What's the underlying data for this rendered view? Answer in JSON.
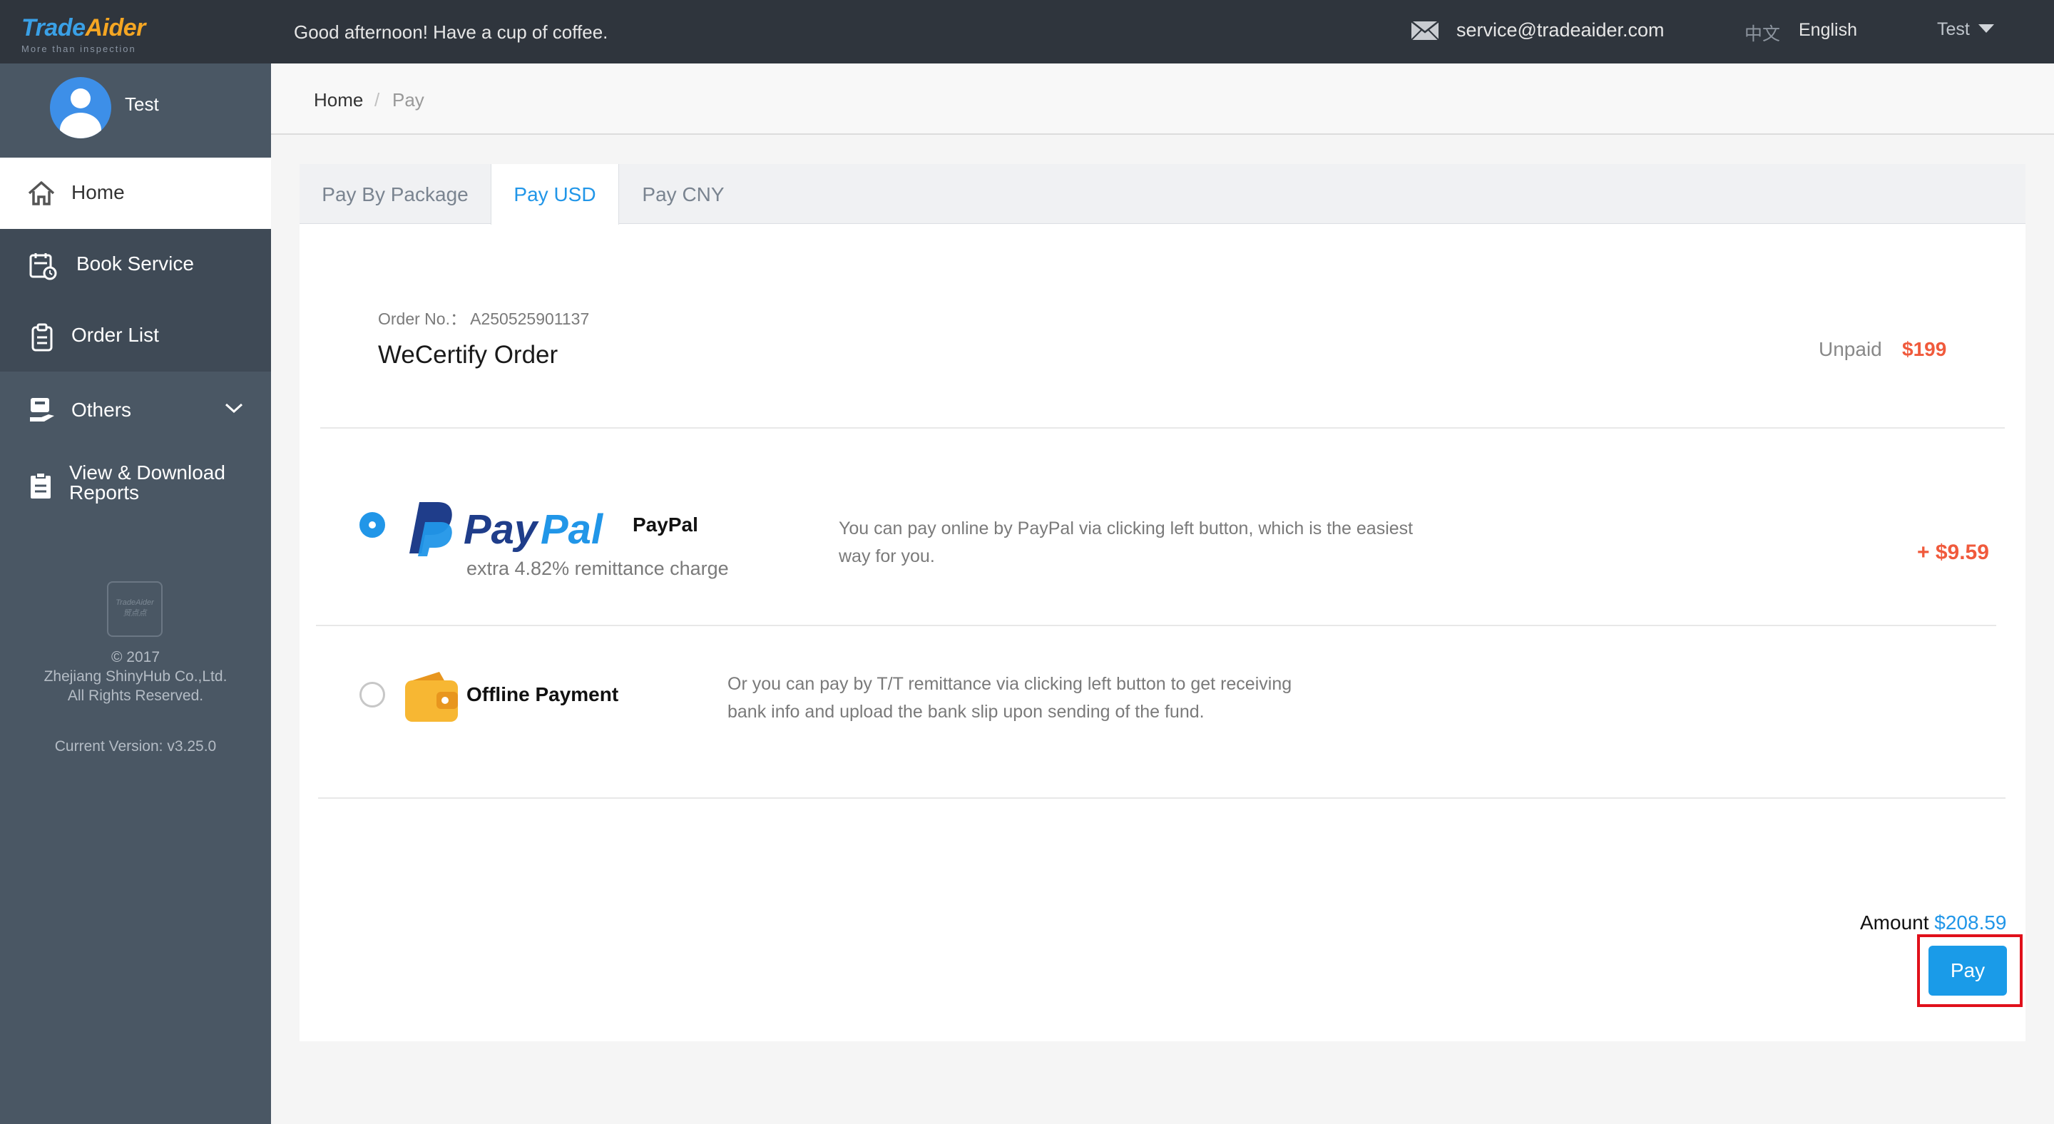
{
  "header": {
    "logo_part1": "Trade",
    "logo_part2": "Aider",
    "slogan": "More than inspection",
    "greeting": "Good afternoon! Have a cup of coffee.",
    "email": "service@tradeaider.com",
    "lang_cn": "中文",
    "lang_en": "English",
    "user": "Test"
  },
  "sidebar": {
    "profile_name": "Test",
    "items": [
      {
        "label": "Home",
        "icon": "home-icon",
        "active": true
      },
      {
        "label": "Book Service",
        "icon": "calendar-icon"
      },
      {
        "label": "Order List",
        "icon": "clipboard-icon"
      },
      {
        "label": "Others",
        "icon": "others-icon"
      },
      {
        "label": "View & Download",
        "label2": "Reports",
        "icon": "report-icon"
      }
    ],
    "footer_logo": "TradeAider",
    "footer_logo_cn": "贸点点",
    "copyright": "© 2017",
    "company": "Zhejiang ShinyHub Co.,Ltd.",
    "rights": "All Rights Reserved.",
    "version": "Current Version: v3.25.0"
  },
  "breadcrumb": {
    "home": "Home",
    "separator": "/",
    "current": "Pay"
  },
  "tabs": [
    "Pay By Package",
    "Pay USD",
    "Pay CNY"
  ],
  "order": {
    "number_label": "Order No.：",
    "number": "A250525901137",
    "title": "WeCertify Order",
    "status": "Unpaid",
    "price": "$199"
  },
  "paypal": {
    "logo_text_1": "Pay",
    "logo_text_2": "Pal",
    "name": "PayPal",
    "charge": "extra 4.82% remittance charge",
    "description": "You can pay online by PayPal via clicking left button, which is the easiest way for you.",
    "fee": "+ $9.59",
    "selected": true
  },
  "offline": {
    "name": "Offline Payment",
    "description": "Or you can pay by T/T remittance via clicking left button to get receiving bank info and upload the bank slip upon sending of the fund.",
    "selected": false
  },
  "summary": {
    "amount_label": "Amount",
    "amount": "$208.59",
    "pay_label": "Pay"
  },
  "colors": {
    "accent": "#2196e8",
    "price": "#f05a3c",
    "sidebar": "#4a5764",
    "topbar": "#2f353d",
    "highlight": "#e0101b"
  }
}
